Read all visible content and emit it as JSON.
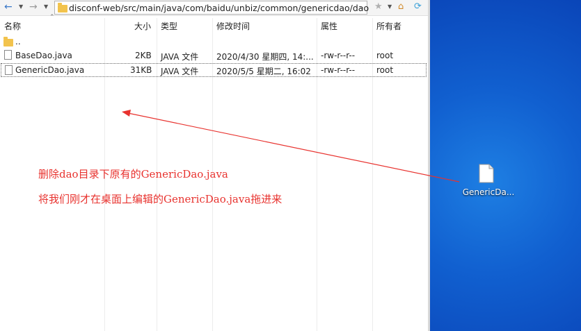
{
  "toolbar": {
    "path": "disconf-web/src/main/java/com/baidu/unbiz/common/genericdao/dao"
  },
  "columns": {
    "name": "名称",
    "size": "大小",
    "type": "类型",
    "modified": "修改时间",
    "attributes": "属性",
    "owner": "所有者"
  },
  "rows": [
    {
      "name": "..",
      "size": "",
      "type": "",
      "modified": "",
      "attributes": "",
      "owner": ""
    },
    {
      "name": "BaseDao.java",
      "size": "2KB",
      "type": "JAVA 文件",
      "modified": "2020/4/30 星期四, 14:...",
      "attributes": "-rw-r--r--",
      "owner": "root"
    },
    {
      "name": "GenericDao.java",
      "size": "31KB",
      "type": "JAVA 文件",
      "modified": "2020/5/5 星期二, 16:02",
      "attributes": "-rw-r--r--",
      "owner": "root"
    }
  ],
  "annotations": {
    "line1": "删除dao目录下原有的GenericDao.java",
    "line2": "将我们刚才在桌面上编辑的GenericDao.java拖进来"
  },
  "desktop": {
    "file_label": "GenericDa..."
  },
  "colors": {
    "annotation": "#e8322e",
    "desktop": "#1160d0"
  }
}
